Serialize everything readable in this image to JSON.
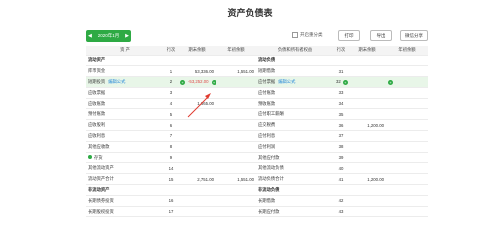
{
  "title": "资产负债表",
  "toolbar": {
    "date": "2020年1月",
    "prev": "◀",
    "next": "▶",
    "checkbox_label": "开启重分类",
    "print": "打印",
    "export": "导出",
    "share": "微信分享"
  },
  "headers": [
    "资 产",
    "行次",
    "期末余额",
    "年初余额",
    "负债和所有者权益",
    "行次",
    "期末余额",
    "年初余额"
  ],
  "rows": [
    {
      "a_name": "流动资产",
      "a_line": "",
      "a_end": "",
      "a_begin": "",
      "l_name": "流动负债",
      "l_line": "",
      "l_end": "",
      "l_begin": "",
      "section": true
    },
    {
      "a_name": "库币资金",
      "a_line": "1",
      "a_end": "53,336.00",
      "a_begin": "1,551.00",
      "l_name": "短期借款",
      "l_line": "31",
      "l_end": "",
      "l_begin": ""
    },
    {
      "a_name": "短期投资",
      "a_link": "编辑公式",
      "a_line": "2",
      "a_end": "-53,252.00",
      "a_begin": "",
      "l_name": "应付票据",
      "l_link": "编辑公式",
      "l_line": "32",
      "l_end": "",
      "l_begin": "",
      "highlight": true
    },
    {
      "a_name": "应收票据",
      "a_line": "3",
      "a_end": "",
      "a_begin": "",
      "l_name": "应付账款",
      "l_line": "33",
      "l_end": "",
      "l_begin": ""
    },
    {
      "a_name": "应收账款",
      "a_line": "4",
      "a_end": "1,665.00",
      "a_begin": "",
      "l_name": "预收账款",
      "l_line": "34",
      "l_end": "",
      "l_begin": ""
    },
    {
      "a_name": "预付账款",
      "a_line": "5",
      "a_end": "",
      "a_begin": "",
      "l_name": "应付职工薪酬",
      "l_line": "35",
      "l_end": "",
      "l_begin": ""
    },
    {
      "a_name": "应收股利",
      "a_line": "6",
      "a_end": "",
      "a_begin": "",
      "l_name": "应交税费",
      "l_line": "36",
      "l_end": "1,200.00",
      "l_begin": ""
    },
    {
      "a_name": "应收利息",
      "a_line": "7",
      "a_end": "",
      "a_begin": "",
      "l_name": "应付利息",
      "l_line": "37",
      "l_end": "",
      "l_begin": ""
    },
    {
      "a_name": "其他应收款",
      "a_line": "8",
      "a_end": "",
      "a_begin": "",
      "l_name": "应付利润",
      "l_line": "38",
      "l_end": "",
      "l_begin": ""
    },
    {
      "a_name": "存货",
      "a_line": "9",
      "a_end": "",
      "a_begin": "",
      "l_name": "其他应付款",
      "l_line": "39",
      "l_end": "",
      "l_begin": "",
      "adot": true
    },
    {
      "a_name": "其他流动资产",
      "a_line": "14",
      "a_end": "",
      "a_begin": "",
      "l_name": "其他流动负债",
      "l_line": "40",
      "l_end": "",
      "l_begin": ""
    },
    {
      "a_name": "流动资产合计",
      "a_line": "15",
      "a_end": "2,751.00",
      "a_begin": "1,551.00",
      "l_name": "流动负债合计",
      "l_line": "41",
      "l_end": "1,200.00",
      "l_begin": ""
    },
    {
      "a_name": "非流动资产",
      "a_line": "",
      "a_end": "",
      "a_begin": "",
      "l_name": "非流动负债",
      "l_line": "",
      "l_end": "",
      "l_begin": "",
      "section": true
    },
    {
      "a_name": "长期债券投资",
      "a_line": "16",
      "a_end": "",
      "a_begin": "",
      "l_name": "长期借款",
      "l_line": "42",
      "l_end": "",
      "l_begin": ""
    },
    {
      "a_name": "长期股权投资",
      "a_line": "17",
      "a_end": "",
      "a_begin": "",
      "l_name": "长期应付款",
      "l_line": "43",
      "l_end": "",
      "l_begin": ""
    }
  ],
  "colors": {
    "accent": "#2eaa44",
    "negative": "#e04b4b",
    "link": "#2a8bd8",
    "highlight": "#e8f6e8",
    "arrow": "#e03a2f"
  }
}
